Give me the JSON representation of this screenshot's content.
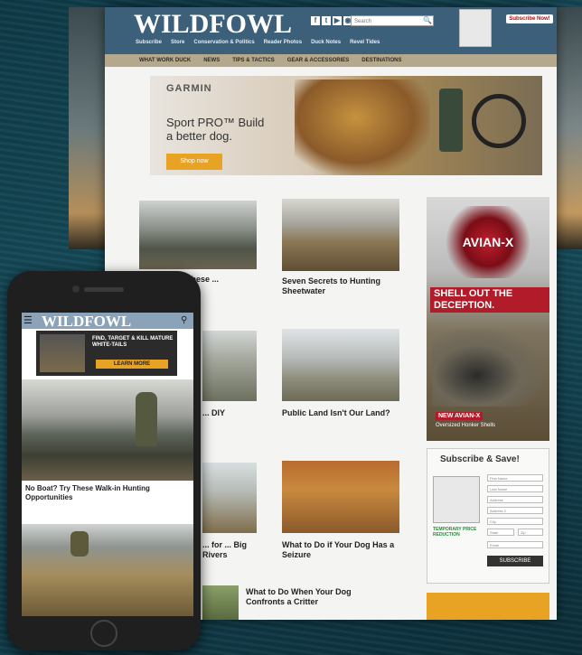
{
  "desktop": {
    "logo": "WILDFOWL",
    "subnav": [
      "Subscribe",
      "Store",
      "Conservation & Politics",
      "Reader Photos",
      "Duck Notes",
      "Revel Tides"
    ],
    "search_placeholder": "Search",
    "subscribe_button": "Subscribe Now!",
    "nav": [
      "WHAT WORK DUCK",
      "NEWS",
      "TIPS & TACTICS",
      "GEAR & ACCESSORIES",
      "DESTINATIONS"
    ],
    "ad": {
      "brand": "GARMIN",
      "headline": "Sport PRO™ Build a better dog.",
      "button": "Shop now"
    },
    "articles": [
      {
        "title": "... These ..."
      },
      {
        "title": "Seven Secrets to Hunting Sheetwater"
      },
      {
        "title": "... DIY"
      },
      {
        "title": "Public Land Isn't Our Land?"
      },
      {
        "title": "... for ... Big Rivers"
      },
      {
        "title": "What to Do if Your Dog Has a Seizure"
      },
      {
        "title": "What to Do When Your Dog Confronts a Critter"
      }
    ],
    "sidebar_ad": {
      "brand": "AVIAN-X",
      "headline": "SHELL OUT THE DECEPTION.",
      "new": "NEW AVIAN-X",
      "product": "Oversized Honker Shells"
    },
    "subscribe": {
      "title": "Subscribe & Save!",
      "fields": [
        "First Name",
        "Last Name",
        "Address",
        "Address 2",
        "City",
        "State",
        "Zip",
        "Email"
      ],
      "offer": "TEMPORARY PRICE REDUCTION",
      "button": "SUBSCRIBE"
    }
  },
  "mobile": {
    "logo": "WILDFOWL",
    "ad": {
      "text": "FIND, TARGET & KILL MATURE WHITE-TAILS",
      "button": "LEARN MORE"
    },
    "article1_caption": "No Boat? Try These Walk-in Hunting Opportunities"
  },
  "colors": {
    "header": "#3c5f7a",
    "nav": "#b5a98d",
    "accent_orange": "#e8a325",
    "ad_red": "#b21b29"
  }
}
